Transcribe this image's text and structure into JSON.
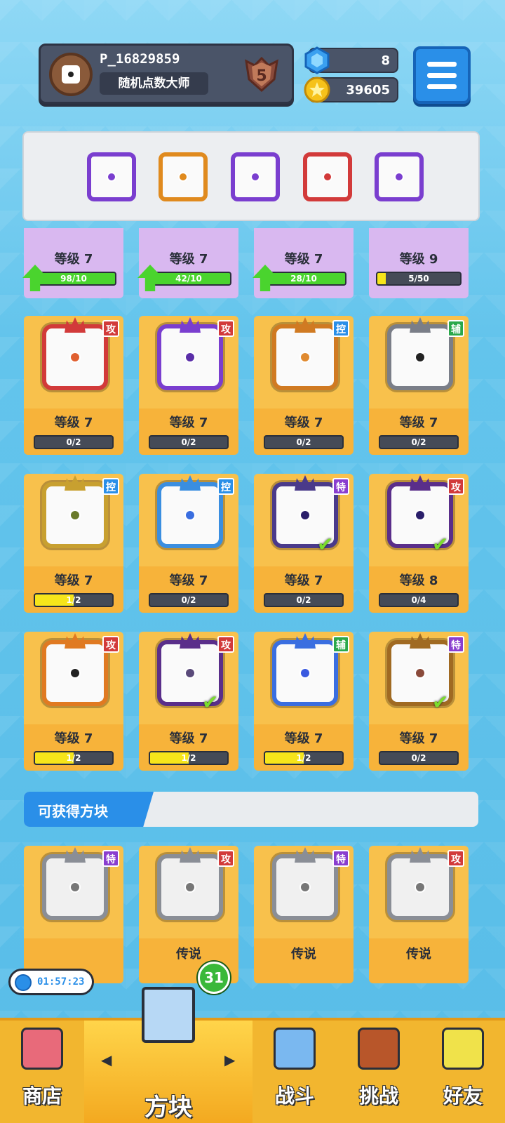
{
  "player": {
    "name": "P_16829859",
    "title": "随机点数大师",
    "rank": "5"
  },
  "resources": {
    "gems": "8",
    "coins": "39605"
  },
  "deck_slots": [
    {
      "name": "combo-dice",
      "color": "#7a3ecf"
    },
    {
      "name": "heart-dice",
      "color": "#e08a1e"
    },
    {
      "name": "magic-circle-dice",
      "color": "#7a3ecf"
    },
    {
      "name": "rainbow-dice",
      "color": "#d23a3a"
    },
    {
      "name": "target-dice",
      "color": "#7a3ecf"
    }
  ],
  "top_row": [
    {
      "level": "等级 7",
      "progress": "98/10",
      "fill": 1.0,
      "upgrade": true
    },
    {
      "level": "等级 7",
      "progress": "42/10",
      "fill": 1.0,
      "upgrade": true
    },
    {
      "level": "等级 7",
      "progress": "28/10",
      "fill": 1.0,
      "upgrade": true
    },
    {
      "level": "等级 9",
      "progress": "5/50",
      "fill": 0.1,
      "upgrade": false
    }
  ],
  "cards": [
    {
      "level": "等级 7",
      "progress": "0/2",
      "fill": 0,
      "tag": "攻",
      "tag_color": "#d23a3a",
      "frame": "#d23a3a",
      "dot": "#e06030",
      "checked": false
    },
    {
      "level": "等级 7",
      "progress": "0/2",
      "fill": 0,
      "tag": "攻",
      "tag_color": "#d23a3a",
      "frame": "#7a3ecf",
      "dot": "#5a2ea8",
      "checked": false
    },
    {
      "level": "等级 7",
      "progress": "0/2",
      "fill": 0,
      "tag": "控",
      "tag_color": "#2a8fe8",
      "frame": "#d07a22",
      "dot": "#e08a30",
      "checked": false
    },
    {
      "level": "等级 7",
      "progress": "0/2",
      "fill": 0,
      "tag": "辅",
      "tag_color": "#2aa84a",
      "frame": "#7a7e88",
      "dot": "#222222",
      "checked": false
    },
    {
      "level": "等级 7",
      "progress": "1/2",
      "fill": 0.5,
      "tag": "控",
      "tag_color": "#2a8fe8",
      "frame": "#c8a030",
      "dot": "#6a7a2a",
      "checked": false
    },
    {
      "level": "等级 7",
      "progress": "0/2",
      "fill": 0,
      "tag": "控",
      "tag_color": "#2a8fe8",
      "frame": "#3a8ee0",
      "dot": "#3a6ee0",
      "checked": false
    },
    {
      "level": "等级 7",
      "progress": "0/2",
      "fill": 0,
      "tag": "特",
      "tag_color": "#8a3ecf",
      "frame": "#4a3a8a",
      "dot": "#2a1e6a",
      "checked": true
    },
    {
      "level": "等级 8",
      "progress": "0/4",
      "fill": 0,
      "tag": "攻",
      "tag_color": "#d23a3a",
      "frame": "#5a2e8a",
      "dot": "#2a1e6a",
      "checked": true
    },
    {
      "level": "等级 7",
      "progress": "1/2",
      "fill": 0.5,
      "tag": "攻",
      "tag_color": "#d23a3a",
      "frame": "#e07a22",
      "dot": "#222222",
      "checked": false
    },
    {
      "level": "等级 7",
      "progress": "1/2",
      "fill": 0.5,
      "tag": "攻",
      "tag_color": "#d23a3a",
      "frame": "#5a2e8a",
      "dot": "#5a4a7a",
      "checked": true
    },
    {
      "level": "等级 7",
      "progress": "1/2",
      "fill": 0.5,
      "tag": "辅",
      "tag_color": "#2aa84a",
      "frame": "#3a6ee0",
      "dot": "#3a5ae0",
      "checked": false
    },
    {
      "level": "等级 7",
      "progress": "0/2",
      "fill": 0,
      "tag": "特",
      "tag_color": "#8a3ecf",
      "frame": "#a06a22",
      "dot": "#8a4a3a",
      "checked": true
    }
  ],
  "available_section": {
    "title": "可获得方块"
  },
  "available": [
    {
      "label": "",
      "tag": "特",
      "tag_color": "#8a3ecf"
    },
    {
      "label": "传说",
      "tag": "攻",
      "tag_color": "#d23a3a"
    },
    {
      "label": "传说",
      "tag": "特",
      "tag_color": "#8a3ecf"
    },
    {
      "label": "传说",
      "tag": "攻",
      "tag_color": "#d23a3a"
    }
  ],
  "timer": "01:57:23",
  "cube_badge": "31",
  "nav": {
    "shop": "商店",
    "dice": "方块",
    "battle": "战斗",
    "challenge": "挑战",
    "friends": "好友"
  }
}
